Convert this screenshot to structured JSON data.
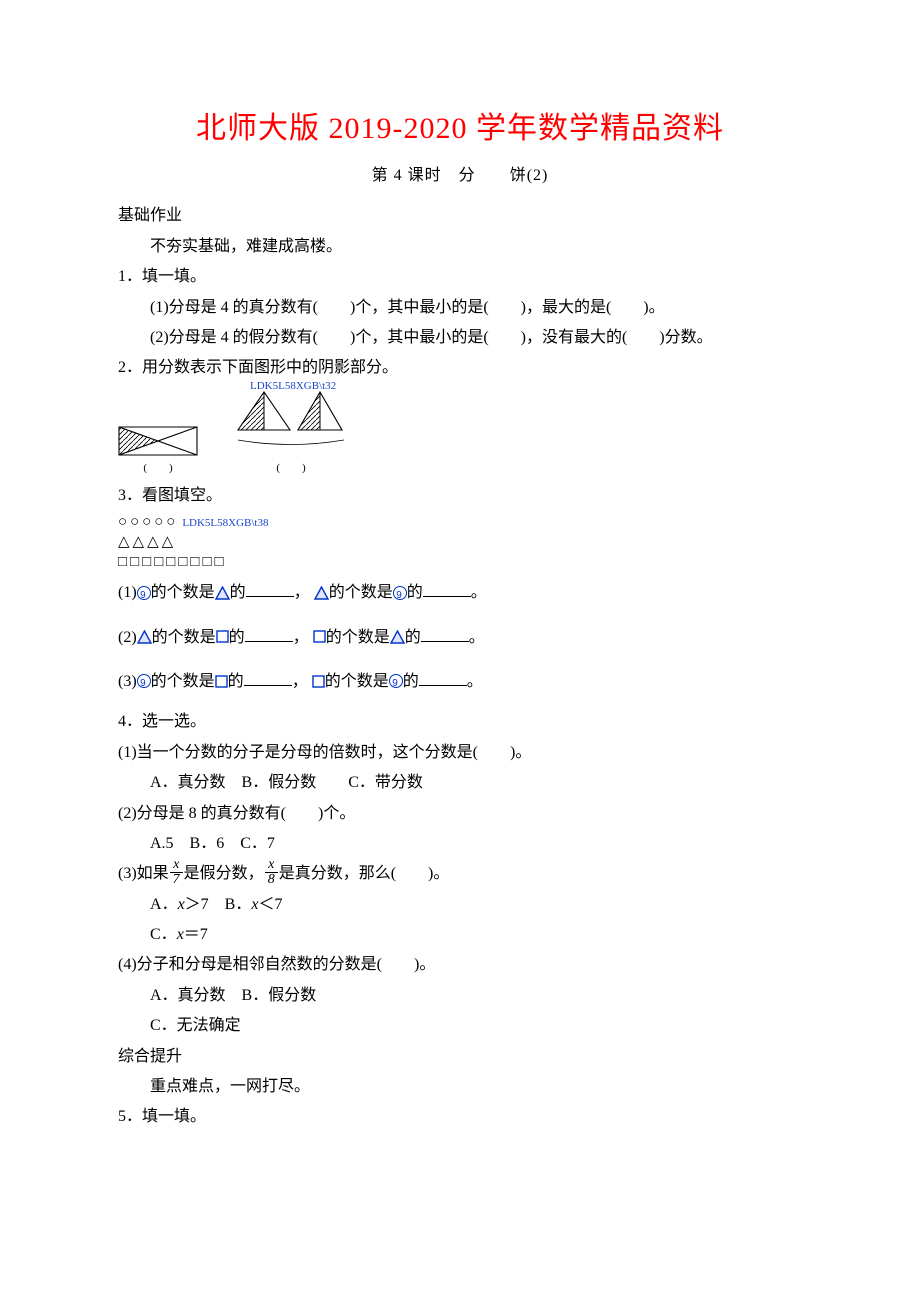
{
  "title": "北师大版 2019-2020 学年数学精品资料",
  "subtitle_a": "第 4 课时",
  "subtitle_b": "分",
  "subtitle_c": "饼(2)",
  "s_basic": "基础作业",
  "s_basic_sub": "不夯实基础，难建成高楼。",
  "q1": {
    "head": "1．填一填。",
    "p1": "(1)分母是 4 的真分数有(　　)个，其中最小的是(　　)，最大的是(　　)。",
    "p2": "(2)分母是 4 的假分数有(　　)个，其中最小的是(　　)，没有最大的(　　)分数。"
  },
  "q2": {
    "head": "2．用分数表示下面图形中的阴影部分。",
    "caption": "(　　)",
    "overlay1": "LDK5L58XGB\\t32"
  },
  "q3": {
    "head": "3．看图填空。",
    "overlay": "LDK5L58XGB\\t38",
    "p1a": "(1)",
    "p1b": "的个数是",
    "p1c": "的",
    "p1d": "，",
    "p1e": "的个数是",
    "p1f": "的",
    "p1g": "。",
    "p2a": "(2)",
    "p3a": "(3)"
  },
  "q4": {
    "head": "4．选一选。",
    "p1": "(1)当一个分数的分子是分母的倍数时，这个分数是(　　)。",
    "p1opt": "A．真分数　B．假分数　　C．带分数",
    "p2": "(2)分母是 8 的真分数有(　　)个。",
    "p2opt": "A.5　B．6　C．7",
    "p3a": "(3)如果",
    "p3b": "是假分数，",
    "p3c": "是真分数，那么(　　)。",
    "p3optA": "A．",
    "p3optAx": "x",
    "p3optAtxt": "＞7　B．",
    "p3optBx": "x",
    "p3optBtxt": "＜7",
    "p3optC": "C．",
    "p3optCx": "x",
    "p3optCtxt": "＝7",
    "p4": " (4)分子和分母是相邻自然数的分数是(　　)。",
    "p4optAB": "A．真分数　B．假分数",
    "p4optC": "C．无法确定",
    "frac1": {
      "num": "x",
      "den": "7"
    },
    "frac2": {
      "num": "x",
      "den": "8"
    }
  },
  "s_comp": "综合提升",
  "s_comp_sub": "重点难点，一网打尽。",
  "q5": {
    "head": "5．填一填。"
  }
}
